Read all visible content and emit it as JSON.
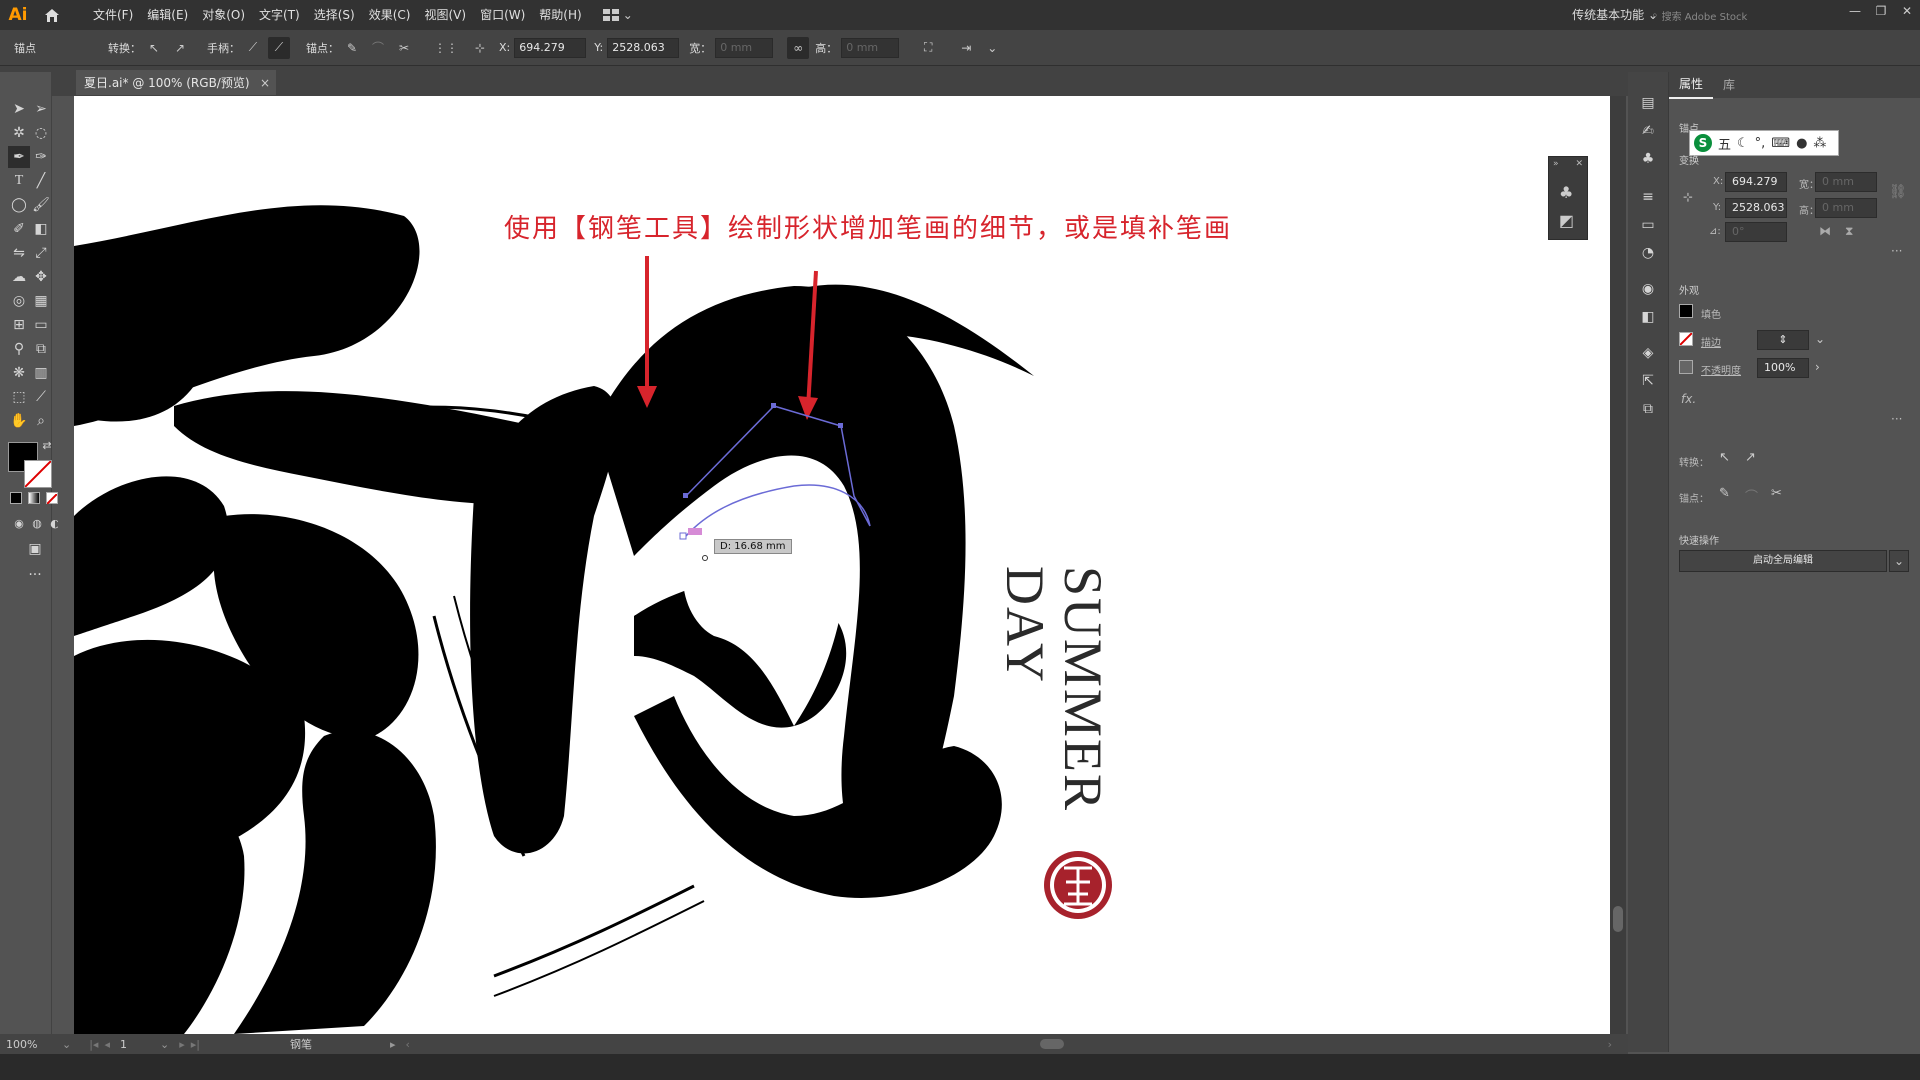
{
  "app": {
    "logo": "Ai"
  },
  "menu": [
    "文件(F)",
    "编辑(E)",
    "对象(O)",
    "文字(T)",
    "选择(S)",
    "效果(C)",
    "视图(V)",
    "窗口(W)",
    "帮助(H)"
  ],
  "workspace": "传统基本功能",
  "search_placeholder": "搜索 Adobe Stock",
  "control": {
    "anchor_label": "锚点",
    "convert_label": "转换：",
    "handle_label": "手柄：",
    "anchors_label": "锚点：",
    "x_label": "X:",
    "x_value": "694.279",
    "y_label": "Y:",
    "y_value": "2528.063",
    "w_label": "宽：",
    "w_value": "0 mm",
    "h_label": "高：",
    "h_value": "0 mm"
  },
  "document_tab": {
    "title": "夏日.ai* @ 100% (RGB/预览)",
    "close": "×"
  },
  "canvas": {
    "annotation": "使用【钢笔工具】绘制形状增加笔画的细节，或是填补笔画",
    "title_line1": "SUMMER",
    "title_line2": "DAY",
    "tooltip": "D: 16.68 mm"
  },
  "panel": {
    "tab_properties": "属性",
    "tab_library": "库",
    "section_anchor": "锚点",
    "section_transform": "变换",
    "x_label": "X:",
    "x_value": "694.279",
    "y_label": "Y:",
    "y_value": "2528.063",
    "w_label": "宽：",
    "w_value": "0 mm",
    "h_label": "高：",
    "h_value": "0 mm",
    "angle_label": "⊿:",
    "angle_value": "0°",
    "section_appearance": "外观",
    "fill_label": "填色",
    "stroke_label": "描边",
    "opacity_label": "不透明度",
    "opacity_value": "100%",
    "fx_label": "fx.",
    "convert_label": "转换：",
    "anchors_label": "锚点：",
    "section_quick": "快速操作",
    "global_edit_button": "启动全局编辑",
    "ime_glyph": "五"
  },
  "status": {
    "zoom": "100%",
    "page": "1",
    "tool": "钢笔"
  },
  "colors": {
    "annotation": "#d7242c",
    "seal": "#a7222c",
    "path": "#6b6bd6"
  }
}
